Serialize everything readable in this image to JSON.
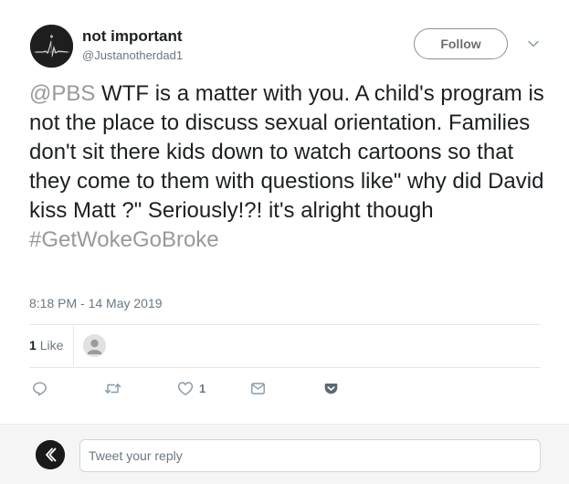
{
  "author": {
    "display_name": "not important",
    "handle": "@Justanotherdad1",
    "avatar_icon": "profile-avatar-waveform"
  },
  "follow_button": {
    "label": "Follow"
  },
  "tweet": {
    "mention": "@PBS",
    "body": " WTF is a matter with you. A child's program is not the place to discuss sexual orientation. Families don't sit there kids down to watch cartoons so that they come to them with questions like\" why did David kiss Matt ?\" Seriously!?! it's alright though ",
    "hashtag": "#GetWokeGoBroke",
    "timestamp": "8:18 PM - 14 May 2019"
  },
  "stats": {
    "likes_count": "1",
    "likes_label": "Like"
  },
  "actions": {
    "reply_icon": "reply-icon",
    "retweet_icon": "retweet-icon",
    "like_icon": "heart-icon",
    "like_count": "1",
    "message_icon": "direct-message-icon",
    "save_icon": "pocket-save-icon"
  },
  "reply": {
    "placeholder": "Tweet your reply"
  },
  "colors": {
    "link": "#999999",
    "text": "#1c2022",
    "muted": "#697882",
    "divider": "#e1e8ed"
  }
}
